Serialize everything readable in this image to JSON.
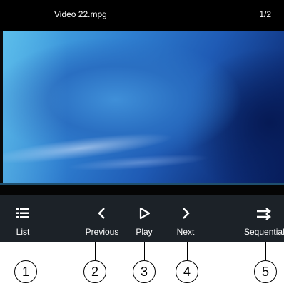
{
  "title_bar": {
    "filename": "Video 22.mpg",
    "page": "1/2"
  },
  "controls": {
    "list": {
      "label": "List",
      "icon": "list-icon"
    },
    "previous": {
      "label": "Previous",
      "icon": "chevron-left-icon"
    },
    "play": {
      "label": "Play",
      "icon": "play-icon"
    },
    "next": {
      "label": "Next",
      "icon": "chevron-right-icon"
    },
    "sequential": {
      "label": "Sequential",
      "icon": "sequential-arrows-icon"
    }
  },
  "callouts": [
    "1",
    "2",
    "3",
    "4",
    "5"
  ],
  "colors": {
    "title_bar_bg": "#000000",
    "control_bar_bg": "#1c2228",
    "video_blue": "#2a6fc2"
  }
}
